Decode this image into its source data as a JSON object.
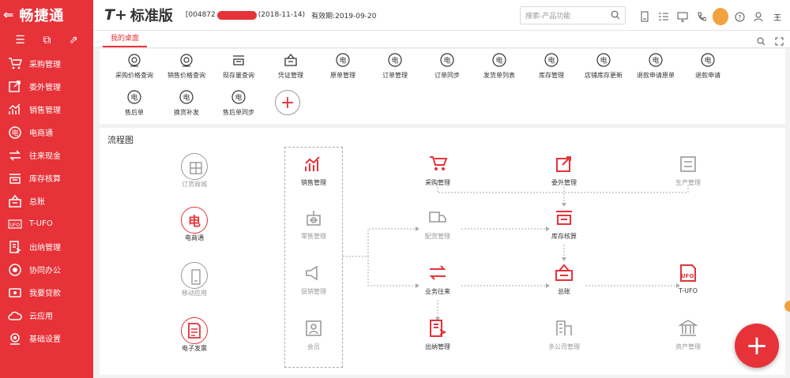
{
  "brand": {
    "name": "畅捷通",
    "color": "#e63238"
  },
  "sidebar": {
    "tools": [
      "menu-icon",
      "window-icon",
      "external-icon"
    ],
    "items": [
      {
        "label": "采购管理",
        "icon": "cart-icon"
      },
      {
        "label": "委外管理",
        "icon": "outsource-icon"
      },
      {
        "label": "销售管理",
        "icon": "sales-chart-icon"
      },
      {
        "label": "电商通",
        "icon": "ecommerce-icon"
      },
      {
        "label": "往来现金",
        "icon": "exchange-icon"
      },
      {
        "label": "库存核算",
        "icon": "stock-icon"
      },
      {
        "label": "总账",
        "icon": "ledger-icon"
      },
      {
        "label": "T-UFO",
        "icon": "ufo-icon"
      },
      {
        "label": "出纳管理",
        "icon": "cashier-icon"
      },
      {
        "label": "协同办公",
        "icon": "collab-icon"
      },
      {
        "label": "我要贷款",
        "icon": "loan-icon"
      },
      {
        "label": "云应用",
        "icon": "cloud-icon"
      },
      {
        "label": "基础设置",
        "icon": "settings-icon"
      }
    ]
  },
  "header": {
    "product": "标准版",
    "product_prefix": "T+",
    "account_prefix": "[004872",
    "account_date": "(2018-11-14)",
    "valid_until": "有效期:2019-09-20",
    "search_placeholder": "搜索-产品功能",
    "user": "王"
  },
  "tabs": {
    "desktop": "我的桌面"
  },
  "quick": [
    {
      "label": "采购价格查询"
    },
    {
      "label": "销售价格查询"
    },
    {
      "label": "现存量查询"
    },
    {
      "label": "凭证管理"
    },
    {
      "label": "原单管理"
    },
    {
      "label": "订单管理"
    },
    {
      "label": "订单同步"
    },
    {
      "label": "发货单列表"
    },
    {
      "label": "库存管理"
    },
    {
      "label": "店铺库存更新"
    },
    {
      "label": "退款申请原单"
    },
    {
      "label": "退款申请"
    },
    {
      "label": "售后单"
    },
    {
      "label": "换货补发"
    },
    {
      "label": "售后单同步"
    }
  ],
  "flow": {
    "title": "流程图",
    "left": [
      {
        "label": "订货商城"
      },
      {
        "label": "电商通"
      },
      {
        "label": "移动应用"
      },
      {
        "label": "电子发票"
      }
    ],
    "mid": [
      {
        "label": "销售管理"
      },
      {
        "label": "零售管理"
      },
      {
        "label": "促销管理"
      },
      {
        "label": "会员"
      }
    ],
    "purchase": "采购管理",
    "outsource": "委外管理",
    "production": "生产管理",
    "distribution": "配货管理",
    "stock": "库存核算",
    "business": "业务往来",
    "ledger": "总账",
    "ufo": "T-UFO",
    "cashier": "出纳管理",
    "multi": "多公司管理",
    "asset": "资产管理"
  },
  "fab": "+"
}
